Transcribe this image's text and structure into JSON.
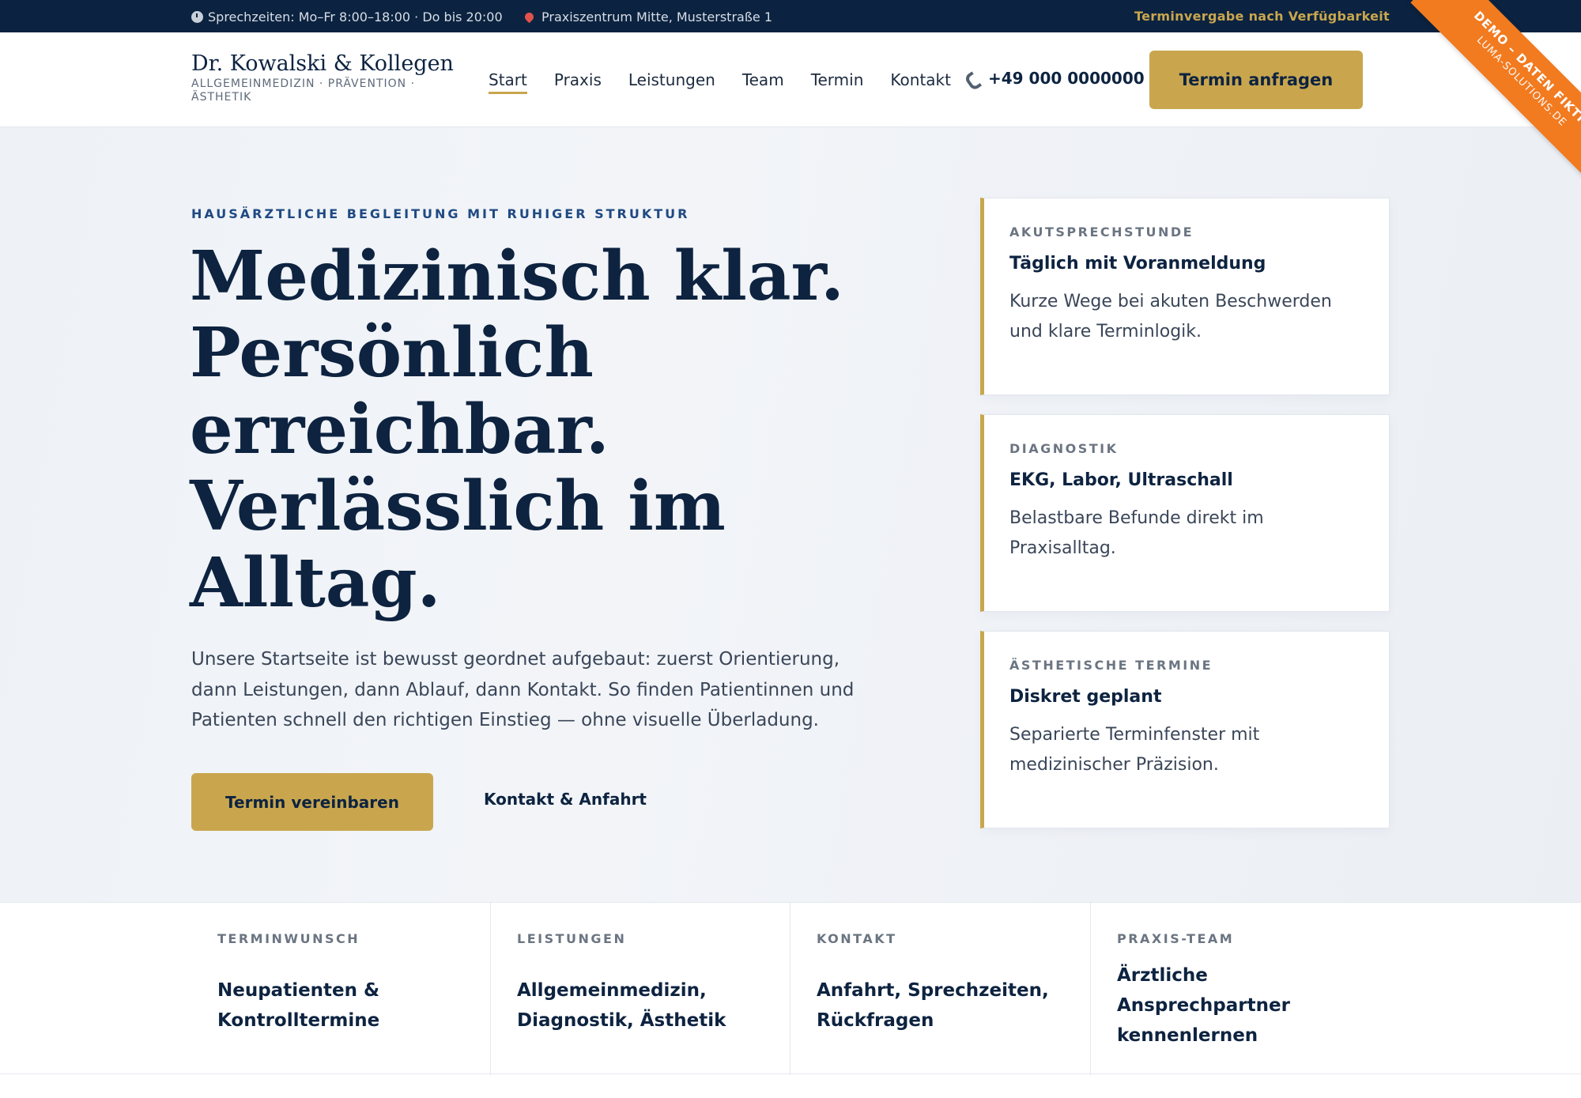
{
  "topbar": {
    "hours": "Sprechzeiten: Mo–Fr 8:00–18:00 · Do bis 20:00",
    "location": "Praxiszentrum Mitte, Musterstraße 1",
    "availability": "Terminvergabe nach Verfügbarkeit"
  },
  "ribbon": {
    "line1": "DEMO – DATEN FIKTIV",
    "line2": "LUMA-SOLUTIONS.DE"
  },
  "brand": {
    "name": "Dr. Kowalski & Kollegen",
    "tagline": "ALLGEMEINMEDIZIN · PRÄVENTION · ÄSTHETIK"
  },
  "nav": {
    "items": [
      "Start",
      "Praxis",
      "Leistungen",
      "Team",
      "Termin",
      "Kontakt"
    ],
    "active": "Start"
  },
  "header": {
    "phone": "+49 000 0000000",
    "cta_label": "Termin anfragen"
  },
  "hero": {
    "eyebrow": "HAUSÄRZTLICHE BEGLEITUNG MIT RUHIGER STRUKTUR",
    "headline_lines": [
      "Medizinisch klar.",
      "Persönlich",
      "erreichbar.",
      "Verlässlich im",
      "Alltag."
    ],
    "lead": "Unsere Startseite ist bewusst geordnet aufgebaut: zuerst Orientierung, dann Leistungen, dann Ablauf, dann Kontakt. So finden Patientinnen und Patienten schnell den richtigen Einstieg — ohne visuelle Überladung.",
    "primary_button": "Termin vereinbaren",
    "secondary_button": "Kontakt & Anfahrt"
  },
  "cards": [
    {
      "kicker": "AKUTSPRECHSTUNDE",
      "title": "Täglich mit Voranmeldung",
      "desc": "Kurze Wege bei akuten Beschwerden und klare Terminlogik."
    },
    {
      "kicker": "DIAGNOSTIK",
      "title": "EKG, Labor, Ultraschall",
      "desc": "Belastbare Befunde direkt im Praxisalltag."
    },
    {
      "kicker": "ÄSTHETISCHE TERMINE",
      "title": "Diskret geplant",
      "desc": "Separierte Terminfenster mit medizinischer Präzision."
    }
  ],
  "strip": [
    {
      "kicker": "TERMINWUNSCH",
      "title": "Neupatienten & Kontrolltermine"
    },
    {
      "kicker": "LEISTUNGEN",
      "title": "Allgemeinmedizin, Diagnostik, Ästhetik"
    },
    {
      "kicker": "KONTAKT",
      "title": "Anfahrt, Sprechzeiten, Rückfragen"
    },
    {
      "kicker": "PRAXIS-TEAM",
      "title": "Ärztliche Ansprechpartner kennenlernen"
    }
  ],
  "colors": {
    "navy": "#0b2340",
    "gold": "#c9a64e",
    "ribbon": "#f27a1f",
    "accent_blue": "#1f4a82"
  },
  "icons": [
    "clock-icon",
    "pin-icon",
    "phone-icon"
  ]
}
